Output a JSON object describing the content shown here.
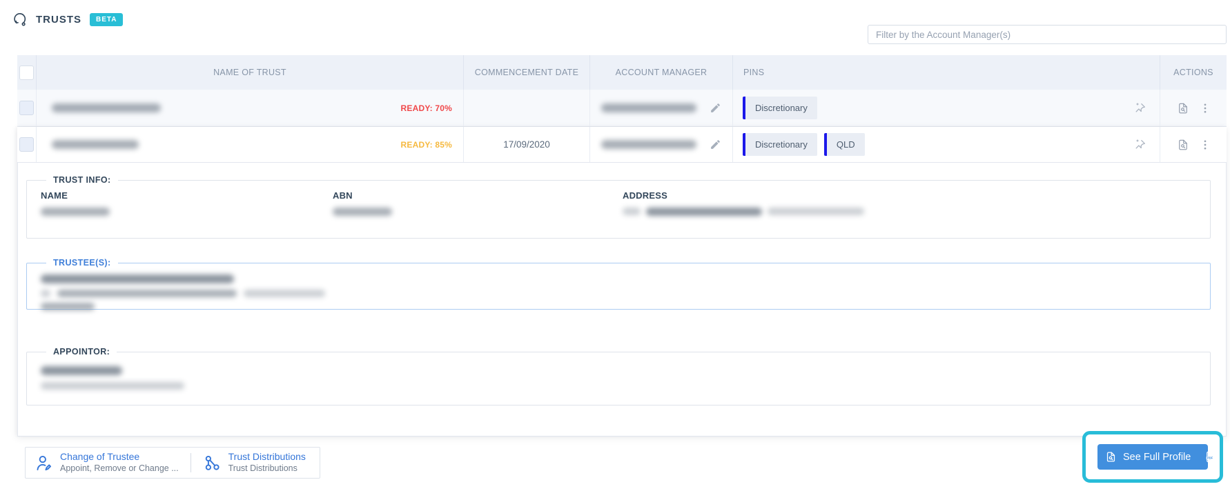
{
  "header": {
    "title": "TRUSTS",
    "beta_label": "BETA"
  },
  "filter": {
    "placeholder": "Filter by the Account Manager(s)"
  },
  "table": {
    "columns": [
      "NAME OF TRUST",
      "COMMENCEMENT DATE",
      "ACCOUNT MANAGER",
      "PINS",
      "ACTIONS"
    ],
    "rows": [
      {
        "ready_label": "READY: 70%",
        "ready_color": "#f0484a",
        "commencement_date": "",
        "pins": [
          "Discretionary"
        ]
      },
      {
        "ready_label": "READY: 85%",
        "ready_color": "#f6b93f",
        "commencement_date": "17/09/2020",
        "pins": [
          "Discretionary",
          "QLD"
        ]
      }
    ]
  },
  "details": {
    "trust_info": {
      "legend": "TRUST INFO:",
      "name_label": "NAME",
      "abn_label": "ABN",
      "address_label": "ADDRESS"
    },
    "trustees": {
      "legend": "TRUSTEE(S):"
    },
    "appointor": {
      "legend": "APPOINTOR:"
    }
  },
  "footer": {
    "actions": [
      {
        "title": "Change of Trustee",
        "subtitle": "Appoint, Remove or Change ...",
        "icon": "user-edit-icon"
      },
      {
        "title": "Trust Distributions",
        "subtitle": "Trust Distributions",
        "icon": "distributions-icon"
      }
    ],
    "profile_button": {
      "label": "See Full Profile",
      "left_icon": "file-search-icon",
      "right_icon": "pdf-icon"
    }
  },
  "colors": {
    "beta_badge": "#29bed6",
    "accent_blue": "#418fde",
    "highlight_ring": "#28bcd8",
    "pin_bar": "#1b18ea",
    "ready_70": "#f0484a",
    "ready_85": "#f6b93f",
    "header_bg": "#edf1f8",
    "title_text": "#33475b"
  }
}
